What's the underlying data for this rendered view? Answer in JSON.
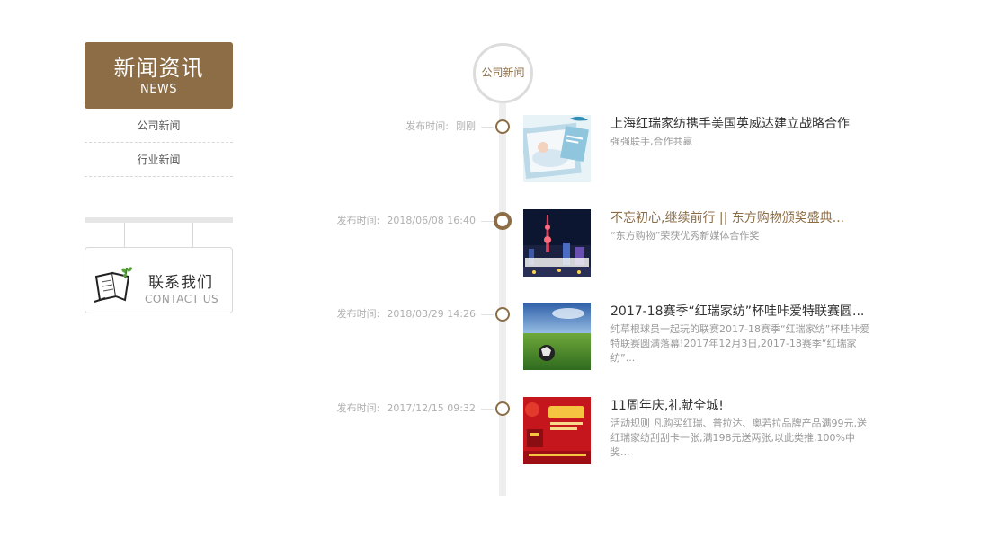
{
  "sidebar": {
    "title_cn": "新闻资讯",
    "title_en": "NEWS",
    "menu": [
      {
        "label": "公司新闻"
      },
      {
        "label": "行业新闻"
      }
    ],
    "contact": {
      "cn": "联系我们",
      "en": "CONTACT US",
      "icon": "open-book-plant-icon"
    }
  },
  "timeline": {
    "header": "公司新闻",
    "accent_color": "#8c6d45",
    "date_label": "发布时间:",
    "entries": [
      {
        "date": "刚刚",
        "title": "上海红瑞家纺携手美国英威达建立战略合作",
        "desc": "强强联手,合作共赢",
        "thumb": "bedding-photo"
      },
      {
        "date": "2018/06/08 16:40",
        "title": "不忘初心,继续前行 || 东方购物颁奖盛典...",
        "desc": "“东方购物”荣获优秀新媒体合作奖",
        "thumb": "city-night-photo"
      },
      {
        "date": "2018/03/29 14:26",
        "title": "2017-18赛季“红瑞家纺”杯哇咔爱特联赛圆...",
        "desc": "纯草根球员一起玩的联赛2017-18赛季“红瑞家纺”杯哇咔爱特联赛圆满落幕!2017年12月3日,2017-18赛季“红瑞家纺”...",
        "thumb": "football-field-photo"
      },
      {
        "date": "2017/12/15 09:32",
        "title": "11周年庆,礼献全城!",
        "desc": "活动规则 凡购买红瑞、普拉达、奥若拉品牌产品满99元,送红瑞家纺刮刮卡一张,满198元送两张,以此类推,100%中奖...",
        "thumb": "anniversary-poster"
      }
    ]
  }
}
